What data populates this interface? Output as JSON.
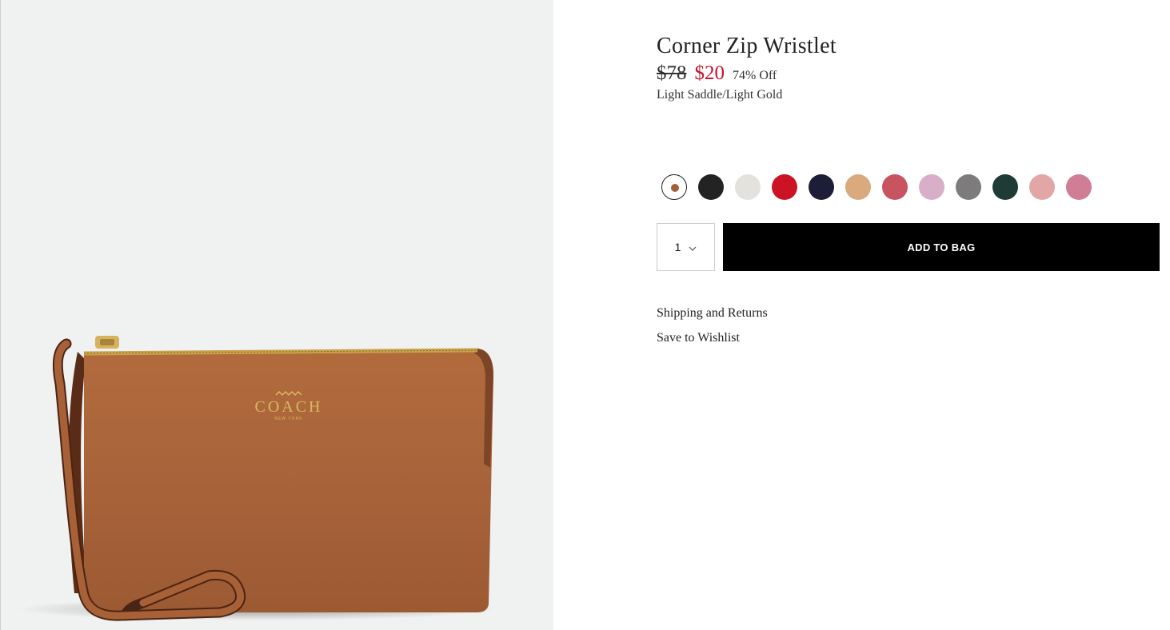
{
  "product": {
    "title": "Corner Zip Wristlet",
    "price_original": "$78",
    "price_sale": "$20",
    "discount": "74% Off",
    "color_name": "Light Saddle/Light Gold",
    "brand_mark": "COACH",
    "brand_sub": "NEW YORK"
  },
  "swatches": [
    {
      "color": "#a0603a",
      "selected": true
    },
    {
      "color": "#232323"
    },
    {
      "color": "#e4e2dd"
    },
    {
      "color": "#cc1326"
    },
    {
      "color": "#1c1d36"
    },
    {
      "color": "#dba97e"
    },
    {
      "color": "#c85462"
    },
    {
      "color": "#d9aec8"
    },
    {
      "color": "#7d7b7b"
    },
    {
      "color": "#1f3b35"
    },
    {
      "color": "#e2a6a6"
    },
    {
      "color": "#cf7e95"
    }
  ],
  "cart": {
    "quantity": "1",
    "add_to_bag_label": "ADD TO BAG"
  },
  "links": {
    "shipping": "Shipping and Returns",
    "wishlist": "Save to Wishlist"
  },
  "icons": {
    "quantity_dropdown": "chevron-down-icon"
  }
}
